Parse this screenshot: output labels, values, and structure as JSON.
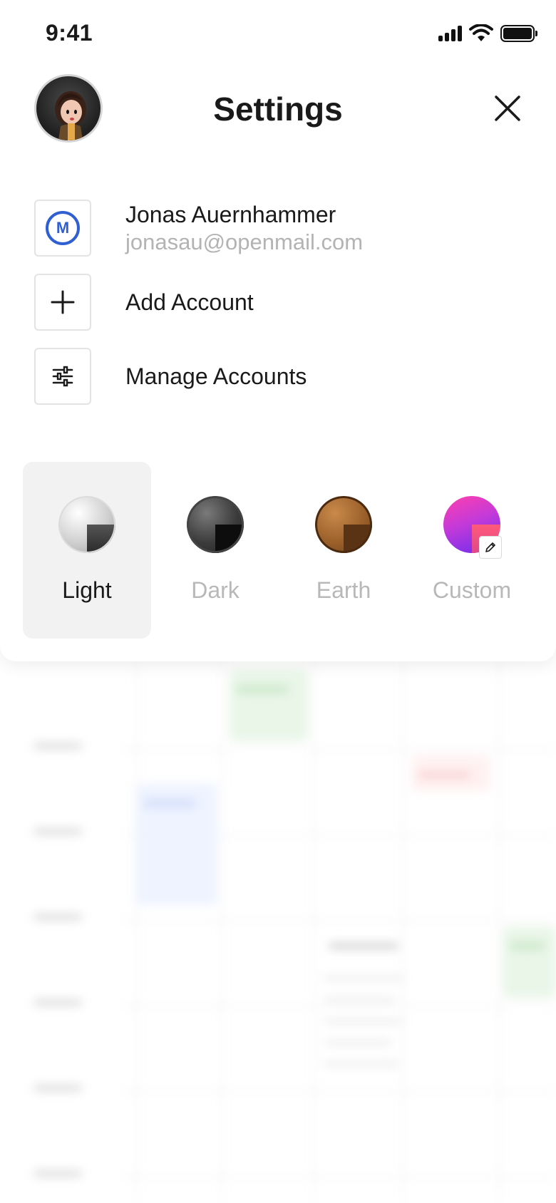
{
  "status_bar": {
    "time": "9:41"
  },
  "header": {
    "title": "Settings"
  },
  "account": {
    "name": "Jonas Auernhammer",
    "email": "jonasau@openmail.com",
    "provider_icon_letter": "M"
  },
  "actions": {
    "add_account": "Add Account",
    "manage_accounts": "Manage Accounts"
  },
  "themes": {
    "selected": "Light",
    "options": [
      {
        "label": "Light"
      },
      {
        "label": "Dark"
      },
      {
        "label": "Earth"
      },
      {
        "label": "Custom"
      }
    ]
  },
  "colors": {
    "accent_blue": "#2f5fd0",
    "selected_bg": "#f2f2f2",
    "muted_text": "#b3b3b3"
  }
}
